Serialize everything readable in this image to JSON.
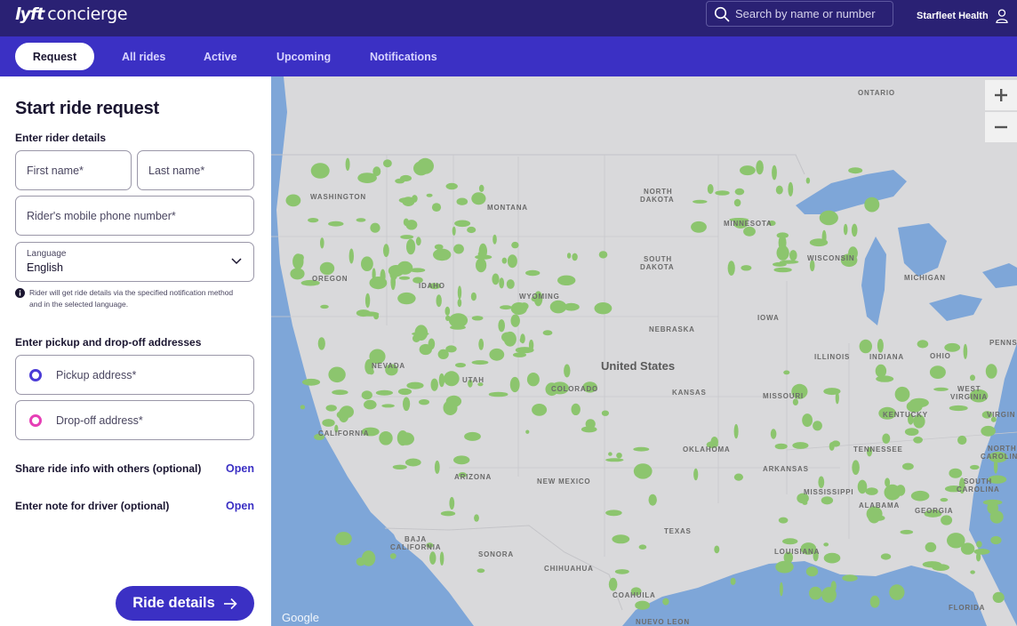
{
  "header": {
    "logo_mark": "lyft",
    "logo_text": "concierge",
    "search_placeholder": "Search by name or number",
    "org_name": "Starfleet Health"
  },
  "nav": {
    "tabs": [
      {
        "label": "Request",
        "active": true
      },
      {
        "label": "All rides"
      },
      {
        "label": "Active"
      },
      {
        "label": "Upcoming"
      },
      {
        "label": "Notifications"
      }
    ]
  },
  "form": {
    "title": "Start ride request",
    "rider_section": "Enter rider details",
    "first_name_placeholder": "First name*",
    "last_name_placeholder": "Last name*",
    "phone_placeholder": "Rider's mobile phone number*",
    "language_label": "Language",
    "language_value": "English",
    "info_text": "Rider will get ride details via the specified notification method and in the selected language.",
    "address_section": "Enter pickup and drop-off addresses",
    "pickup_placeholder": "Pickup address*",
    "dropoff_placeholder": "Drop-off address*",
    "share_label": "Share ride info with others (optional)",
    "share_link": "Open",
    "note_label": "Enter note for driver (optional)",
    "note_link": "Open",
    "submit_label": "Ride details"
  },
  "map": {
    "country_label": "United States",
    "attribution": "Google",
    "labels": [
      "ONTARIO",
      "WASHINGTON",
      "MONTANA",
      "NORTH",
      "DAKOTA",
      "MINNESOTA",
      "WISCONSIN",
      "MICHIGAN",
      "SOUTH",
      "DAKOTA",
      "OREGON",
      "IDAHO",
      "WYOMING",
      "IOWA",
      "NEBRASKA",
      "PENNS",
      "ILLINOIS",
      "INDIANA",
      "OHIO",
      "NEVADA",
      "UTAH",
      "COLORADO",
      "KANSAS",
      "MISSOURI",
      "WEST",
      "VIRGINIA",
      "KENTUCKY",
      "VIRGIN",
      "CALIFORNIA",
      "OKLAHOMA",
      "TENNESSEE",
      "NORTH",
      "CAROLIN",
      "ARKANSAS",
      "ARIZONA",
      "NEW MEXICO",
      "SOUTH",
      "CAROLINA",
      "MISSISSIPPI",
      "ALABAMA",
      "GEORGIA",
      "TEXAS",
      "BAJA",
      "CALIFORNIA",
      "SONORA",
      "LOUISIANA",
      "CHIHUAHUA",
      "COAHUILA",
      "FLORIDA",
      "NUEVO LEON"
    ]
  },
  "colors": {
    "header_bg": "#2a2174",
    "nav_bg": "#3b30c4",
    "accent": "#3b30c4",
    "pickup_dot": "#4b3bd6",
    "dropoff_dot": "#e63fb6",
    "water": "#7ea6d8",
    "land": "#d9d9db",
    "park": "#8cc56e"
  }
}
